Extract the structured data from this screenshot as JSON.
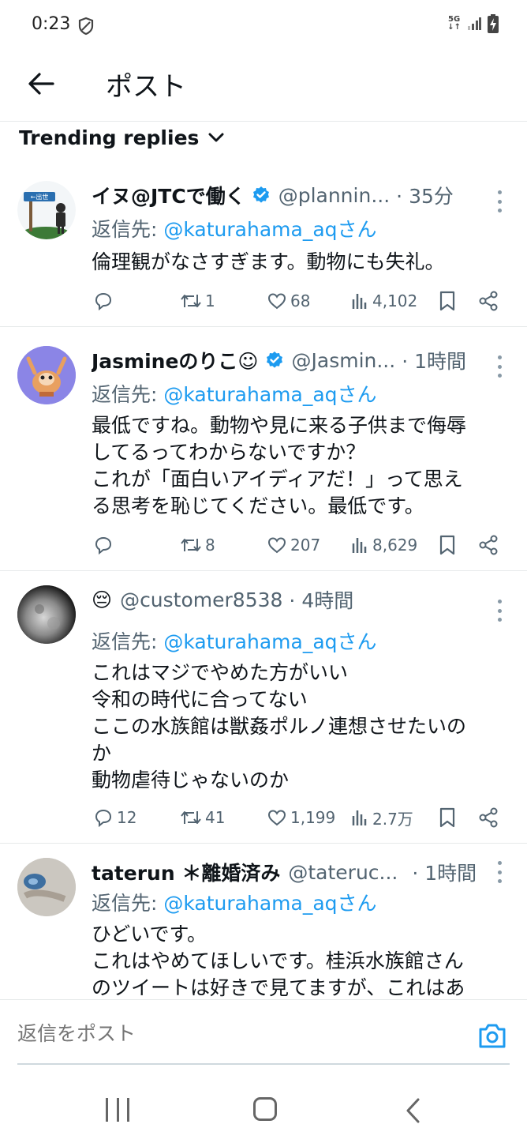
{
  "status_bar": {
    "time": "0:23",
    "network": "5G",
    "icons": [
      "shield-icon",
      "signal-icon",
      "battery-charging-icon"
    ]
  },
  "header": {
    "back_icon": "arrow-left-icon",
    "title": "ポスト"
  },
  "sort": {
    "label": "Trending replies",
    "icon": "chevron-down-icon"
  },
  "colors": {
    "accent": "#1d9bf0",
    "text": "#0f1419",
    "muted": "#536471",
    "divider": "#e6e9ea"
  },
  "posts": [
    {
      "display_name": "イヌ@JTCで働く",
      "verified": true,
      "handle": "@plannin...",
      "time": "· 35分",
      "reply_prefix": "返信先: ",
      "reply_mention": "@katurahama_aqさん",
      "lines": [
        "倫理観がなさすぎます。動物にも失礼。"
      ],
      "stats": {
        "replies": "",
        "reposts": "1",
        "likes": "68",
        "views": "4,102"
      }
    },
    {
      "display_name": "Jasmineのりこ☺",
      "verified": true,
      "handle": "@Jasmin...",
      "time": "· 1時間",
      "reply_prefix": "返信先: ",
      "reply_mention": "@katurahama_aqさん",
      "lines": [
        "最低ですね。動物や見に来る子供まで侮辱",
        "してるってわからないですか？",
        "これが「面白いアイディアだ！」って思え",
        "る思考を恥じてください。最低です。"
      ],
      "stats": {
        "replies": "",
        "reposts": "8",
        "likes": "207",
        "views": "8,629"
      }
    },
    {
      "display_name": "😔",
      "verified": false,
      "handle": "@customer8538",
      "time": "· 4時間",
      "reply_prefix": "返信先: ",
      "reply_mention": "@katurahama_aqさん",
      "lines": [
        "これはマジでやめた方がいい",
        "令和の時代に合ってない",
        "ここの水族館は獣姦ポルノ連想させたいの",
        "か",
        "動物虐待じゃないのか"
      ],
      "stats": {
        "replies": "12",
        "reposts": "41",
        "likes": "1,199",
        "views": "2.7万"
      }
    },
    {
      "display_name": "taterun ＊離婚済み",
      "verified": false,
      "handle": "@tateruc...",
      "time": "· 1時間",
      "reply_prefix": "返信先: ",
      "reply_mention": "@katurahama_aqさん",
      "lines": [
        "ひどいです。",
        "これはやめてほしいです。桂浜水族館さん",
        "のツイートは好きで見てますが、これはあ"
      ],
      "stats": {
        "replies": "",
        "reposts": "",
        "likes": "",
        "views": ""
      }
    }
  ],
  "composer": {
    "placeholder": "返信をポスト",
    "camera_icon": "camera-icon"
  },
  "nav_bar": {
    "icons": [
      "recents-icon",
      "home-icon",
      "back-icon"
    ]
  }
}
